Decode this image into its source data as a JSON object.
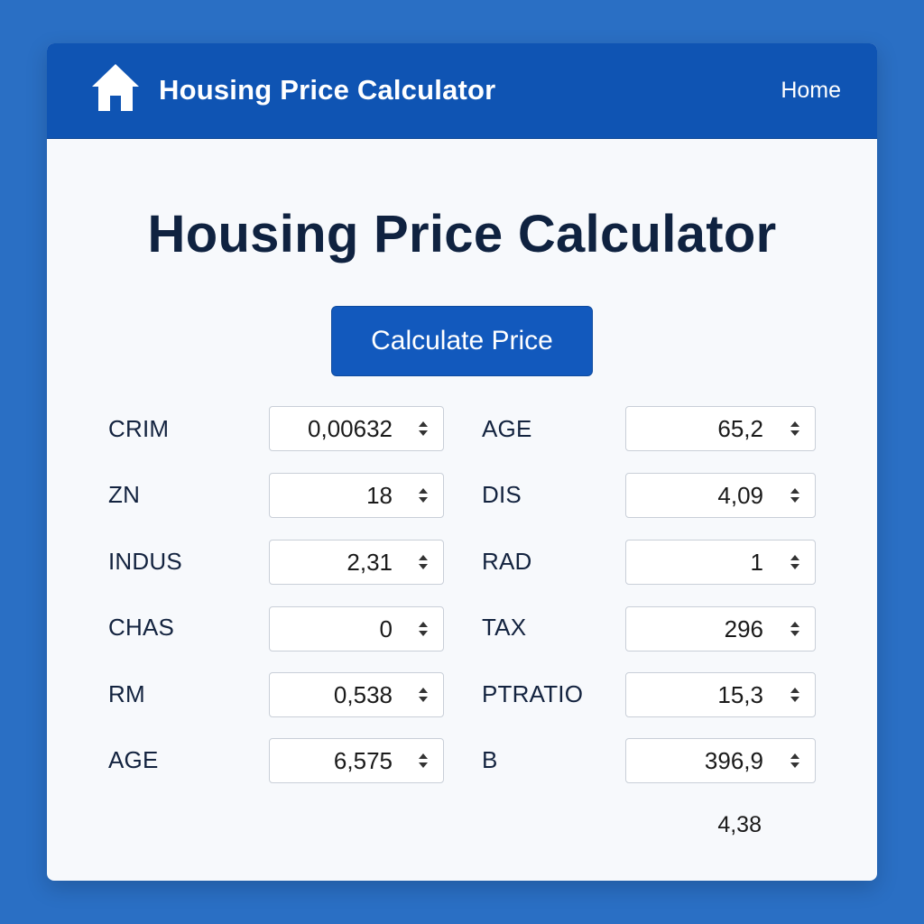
{
  "navbar": {
    "logo_icon": "house-icon",
    "title": "Housing Price Calculator",
    "home_link": "Home"
  },
  "main": {
    "title": "Housing Price Calculator",
    "calculate_button": "Calculate Price"
  },
  "form": {
    "left": [
      {
        "label": "CRIM",
        "value": "0,00632"
      },
      {
        "label": "ZN",
        "value": "18"
      },
      {
        "label": "INDUS",
        "value": "2,31"
      },
      {
        "label": "CHAS",
        "value": "0"
      },
      {
        "label": "RM",
        "value": "0,538"
      },
      {
        "label": "AGE",
        "value": "6,575"
      }
    ],
    "right": [
      {
        "label": "AGE",
        "value": "65,2"
      },
      {
        "label": "DIS",
        "value": "4,09"
      },
      {
        "label": "RAD",
        "value": "1"
      },
      {
        "label": "TAX",
        "value": "296"
      },
      {
        "label": "PTRATIO",
        "value": "15,3"
      },
      {
        "label": "B",
        "value": "396,9"
      }
    ]
  },
  "result_value": "4,38",
  "colors": {
    "page_background": "#2a6fc4",
    "navbar": "#0f54b3",
    "button": "#1259bd",
    "title_text": "#0f2240"
  }
}
